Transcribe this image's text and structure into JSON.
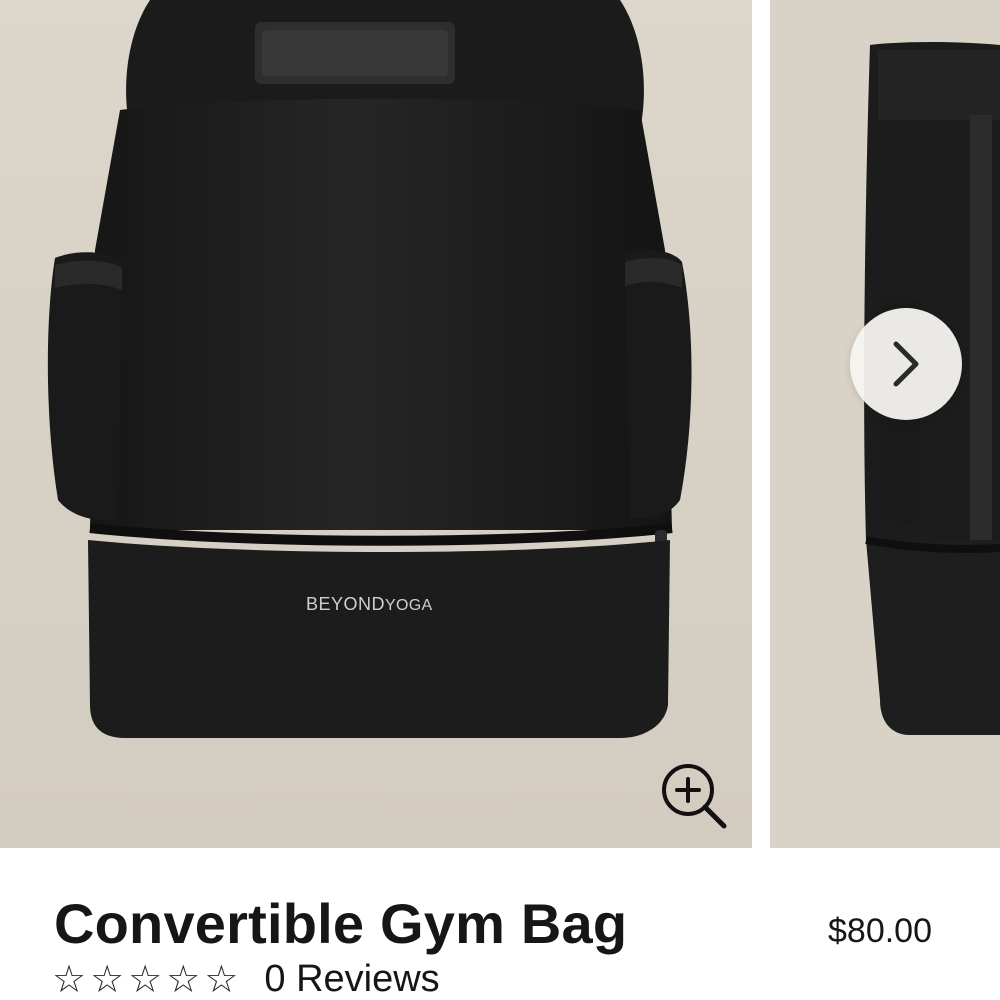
{
  "product": {
    "title": "Convertible Gym Bag",
    "price": "$80.00",
    "brand_logo_text_bold": "BEYOND",
    "brand_logo_text_light": "YOGA",
    "rating": {
      "stars_filled": 0,
      "stars_total": 5,
      "star_glyph": "☆",
      "reviews_label": "0 Reviews"
    }
  },
  "gallery": {
    "zoom_icon": "zoom-in-icon",
    "next_icon": "chevron-right-icon",
    "background_color": "#dcd6cb",
    "bag_color": "#1e1e1e"
  }
}
